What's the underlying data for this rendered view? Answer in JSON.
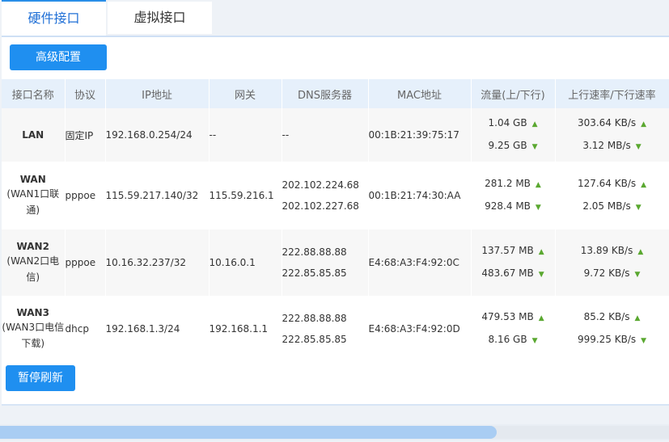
{
  "tabs": [
    "硬件接口",
    "虚拟接口"
  ],
  "buttons": {
    "advanced": "高级配置",
    "pause_refresh": "暂停刷新"
  },
  "table": {
    "headers": [
      "接口名称",
      "协议",
      "IP地址",
      "网关",
      "DNS服务器",
      "MAC地址",
      "流量(上/下行)",
      "上行速率/下行速率"
    ],
    "rows": [
      {
        "name": "LAN",
        "sub": "",
        "protocol": "固定IP",
        "ip": "192.168.0.254/24",
        "gateway": "--",
        "dns": [
          "--",
          ""
        ],
        "mac": "00:1B:21:39:75:17",
        "traffic_up": "1.04 GB",
        "traffic_down": "9.25 GB",
        "rate_up": "303.64 KB/s",
        "rate_down": "3.12 MB/s"
      },
      {
        "name": "WAN",
        "sub": "(WAN1口联通)",
        "protocol": "pppoe",
        "ip": "115.59.217.140/32",
        "gateway": "115.59.216.1",
        "dns": [
          "202.102.224.68",
          "202.102.227.68"
        ],
        "mac": "00:1B:21:74:30:AA",
        "traffic_up": "281.2 MB",
        "traffic_down": "928.4 MB",
        "rate_up": "127.64 KB/s",
        "rate_down": "2.05 MB/s"
      },
      {
        "name": "WAN2",
        "sub": "(WAN2口电信)",
        "protocol": "pppoe",
        "ip": "10.16.32.237/32",
        "gateway": "10.16.0.1",
        "dns": [
          "222.88.88.88",
          "222.85.85.85"
        ],
        "mac": "E4:68:A3:F4:92:0C",
        "traffic_up": "137.57 MB",
        "traffic_down": "483.67 MB",
        "rate_up": "13.89 KB/s",
        "rate_down": "9.72 KB/s"
      },
      {
        "name": "WAN3",
        "sub": "(WAN3口电信下载)",
        "protocol": "dhcp",
        "ip": "192.168.1.3/24",
        "gateway": "192.168.1.1",
        "dns": [
          "222.88.88.88",
          "222.85.85.85"
        ],
        "mac": "E4:68:A3:F4:92:0D",
        "traffic_up": "479.53 MB",
        "traffic_down": "8.16 GB",
        "rate_up": "85.2 KB/s",
        "rate_down": "999.25 KB/s"
      }
    ]
  },
  "icons": {
    "up": "arrow-up-icon",
    "down": "arrow-down-icon"
  },
  "colors": {
    "accent": "#1f8ff0",
    "arrow": "#5aa830",
    "header_bg": "#e6f0fb"
  },
  "scrollbar": {
    "position_fraction": 0.74
  }
}
